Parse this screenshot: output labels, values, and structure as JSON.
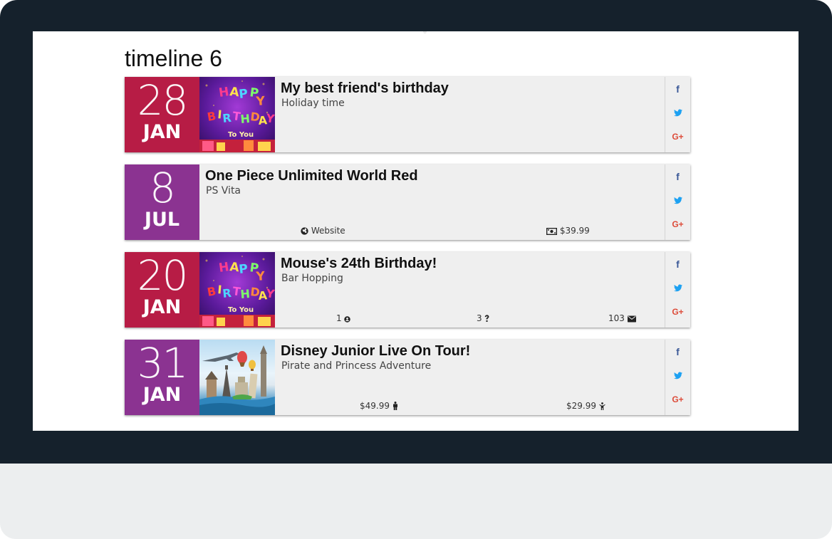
{
  "page": {
    "title": "timeline 6"
  },
  "events": [
    {
      "day": "28",
      "month": "JAN",
      "title": "My best friend's birthday",
      "subtitle": "Holiday time",
      "image": "happy-birthday",
      "color": "#b71c45"
    },
    {
      "day": "8",
      "month": "JUL",
      "title": "One Piece Unlimited World Red",
      "subtitle": "PS Vita",
      "image": "",
      "color": "#8b3391",
      "meta": {
        "website": "Website",
        "price": "$39.99"
      }
    },
    {
      "day": "20",
      "month": "JAN",
      "title": "Mouse's 24th Birthday!",
      "subtitle": "Bar Hopping",
      "image": "happy-birthday",
      "color": "#b71c45",
      "meta": {
        "going": "1",
        "maybe": "3",
        "invited": "103"
      }
    },
    {
      "day": "31",
      "month": "JAN",
      "title": "Disney Junior Live On Tour!",
      "subtitle": "Pirate and Princess Adventure",
      "image": "travel-landmarks",
      "color": "#8b3391",
      "meta": {
        "adult_price": "$49.99",
        "child_price": "$29.99"
      }
    }
  ],
  "icons": {
    "facebook": "facebook-icon",
    "twitter": "twitter-icon",
    "google_plus": "google-plus-icon",
    "globe": "globe-icon",
    "money": "money-icon",
    "user": "user-icon",
    "question": "question-icon",
    "envelope": "envelope-icon",
    "child": "child-icon"
  },
  "social_labels": {
    "facebook": "f",
    "google_plus": "G+"
  },
  "colors": {
    "bezel": "#15212c",
    "stand": "#eceeef",
    "crimson": "#b71c45",
    "purple": "#8b3391",
    "card": "#efefef",
    "facebook": "#3b5998",
    "twitter": "#1da1f2",
    "google_plus": "#dd4b39"
  }
}
